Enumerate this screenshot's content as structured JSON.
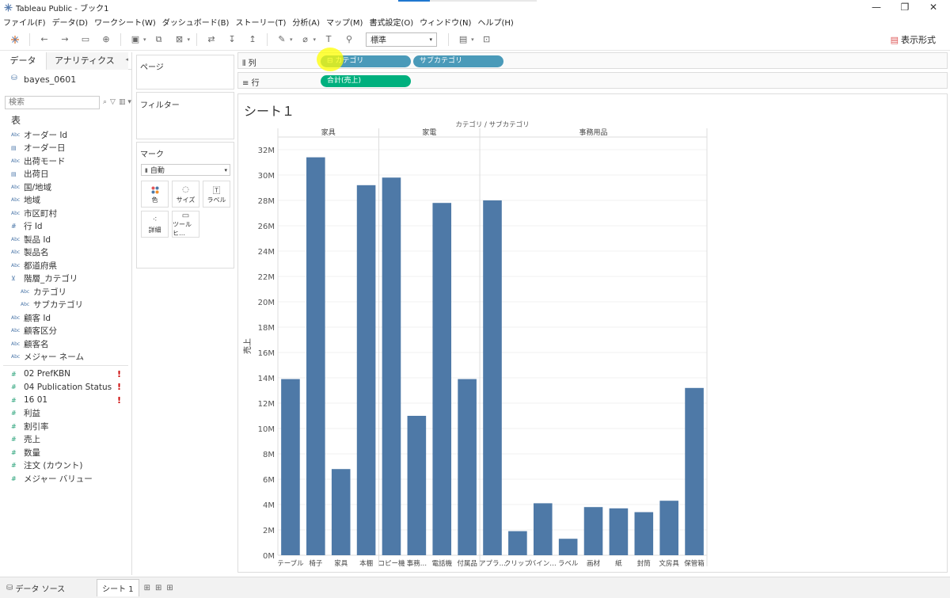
{
  "window": {
    "title": "Tableau Public - ブック1"
  },
  "menu": [
    "ファイル(F)",
    "データ(D)",
    "ワークシート(W)",
    "ダッシュボード(B)",
    "ストーリー(T)",
    "分析(A)",
    "マップ(M)",
    "書式設定(O)",
    "ウィンドウ(N)",
    "ヘルプ(H)"
  ],
  "toolbar": {
    "fit": "標準",
    "show_me": "表示形式"
  },
  "data_pane": {
    "tab_data": "データ",
    "tab_analytics": "アナリティクス",
    "datasource": "bayes_0601",
    "search_placeholder": "検索",
    "tables_header": "表",
    "dimensions": [
      {
        "label": "オーダー Id",
        "type": "Abc"
      },
      {
        "label": "オーダー日",
        "type": "date"
      },
      {
        "label": "出荷モード",
        "type": "Abc"
      },
      {
        "label": "出荷日",
        "type": "date"
      },
      {
        "label": "国/地域",
        "type": "Abc"
      },
      {
        "label": "地域",
        "type": "Abc"
      },
      {
        "label": "市区町村",
        "type": "Abc"
      },
      {
        "label": "行 Id",
        "type": "#"
      },
      {
        "label": "製品 Id",
        "type": "Abc"
      },
      {
        "label": "製品名",
        "type": "Abc"
      },
      {
        "label": "都道府県",
        "type": "Abc"
      },
      {
        "label": "階層_カテゴリ",
        "type": "hier"
      },
      {
        "label": "カテゴリ",
        "type": "Abc",
        "child": true
      },
      {
        "label": "サブカテゴリ",
        "type": "Abc",
        "child": true
      },
      {
        "label": "顧客 Id",
        "type": "Abc"
      },
      {
        "label": "顧客区分",
        "type": "Abc"
      },
      {
        "label": "顧客名",
        "type": "Abc"
      },
      {
        "label": "メジャー ネーム",
        "type": "Abc"
      }
    ],
    "measures": [
      {
        "label": "02 PrefKBN",
        "warn": true
      },
      {
        "label": "04 Publication Status",
        "warn": true
      },
      {
        "label": "16 01",
        "warn": true
      },
      {
        "label": "利益"
      },
      {
        "label": "割引率"
      },
      {
        "label": "売上"
      },
      {
        "label": "数量"
      },
      {
        "label": "注文 (カウント)"
      },
      {
        "label": "メジャー バリュー"
      }
    ]
  },
  "cards": {
    "pages": "ページ",
    "filters": "フィルター",
    "marks": "マーク",
    "marks_type": "自動",
    "mark_buttons": [
      "色",
      "サイズ",
      "ラベル",
      "詳細",
      "ツールヒ…"
    ]
  },
  "shelves": {
    "columns_label": "列",
    "rows_label": "行",
    "column_pills": [
      "カテゴリ",
      "サブカテゴリ"
    ],
    "row_pills": [
      "合計(売上)"
    ]
  },
  "sheet": {
    "title": "シート１"
  },
  "chart_data": {
    "type": "bar",
    "header": "カテゴリ / サブカテゴリ",
    "ylabel": "売上",
    "ylim": [
      0,
      32
    ],
    "yunit": "M",
    "yticks": [
      "0M",
      "2M",
      "4M",
      "6M",
      "8M",
      "10M",
      "12M",
      "14M",
      "16M",
      "18M",
      "20M",
      "22M",
      "24M",
      "26M",
      "28M",
      "30M",
      "32M"
    ],
    "groups": [
      {
        "name": "家具",
        "categories": [
          "テーブル",
          "椅子",
          "家具",
          "本棚"
        ],
        "values": [
          13.9,
          31.4,
          6.8,
          29.2
        ]
      },
      {
        "name": "家電",
        "categories": [
          "コピー機",
          "事務…",
          "電話機",
          "付属品"
        ],
        "values": [
          29.8,
          11.0,
          27.8,
          13.9
        ]
      },
      {
        "name": "事務用品",
        "categories": [
          "アプラ…",
          "クリップ",
          "バイン…",
          "ラベル",
          "画材",
          "紙",
          "封筒",
          "文房具",
          "保管箱"
        ],
        "values": [
          28.0,
          1.9,
          4.1,
          1.3,
          3.8,
          3.7,
          3.4,
          4.3,
          13.2
        ]
      }
    ],
    "bar_color": "#4e79a7"
  },
  "bottom": {
    "datasource_tab": "データ ソース",
    "sheet_tab": "シート 1"
  }
}
